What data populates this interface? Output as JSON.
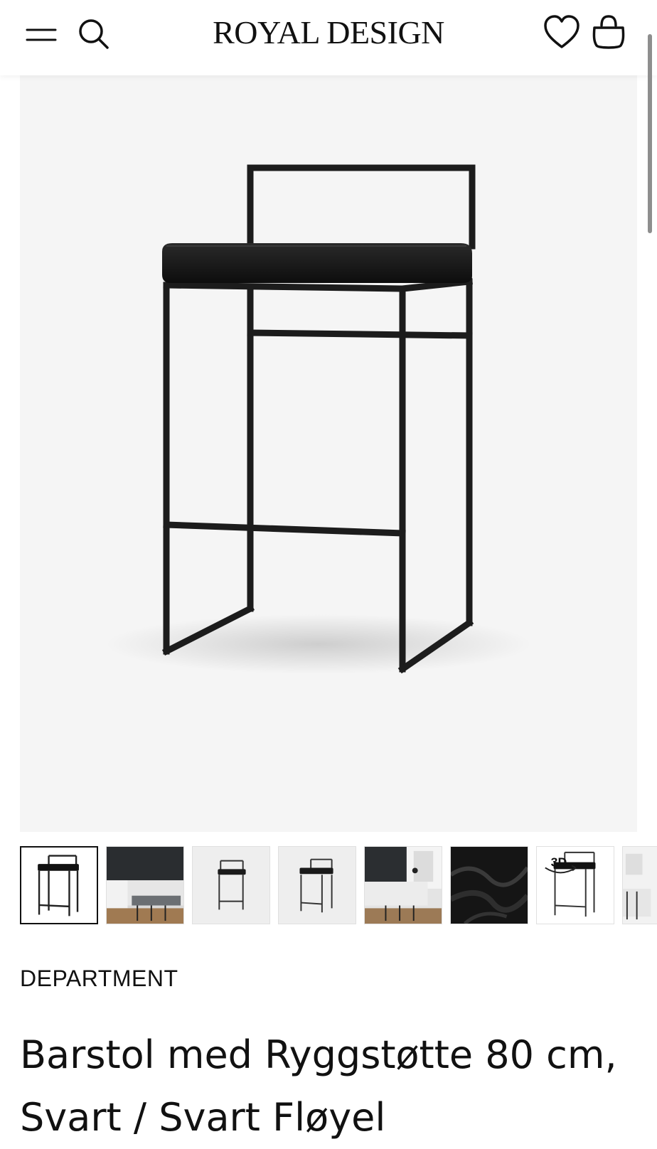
{
  "header": {
    "logo": "ROYAL DESIGN",
    "icons": {
      "menu": "hamburger-menu-icon",
      "search": "search-icon",
      "favorites": "heart-icon",
      "cart": "shopping-bag-icon"
    }
  },
  "gallery": {
    "main_image": "bar-stool-product-image",
    "thumbnails": [
      {
        "name": "stool-front-view",
        "active": true
      },
      {
        "name": "kitchen-scene"
      },
      {
        "name": "stool-side-view"
      },
      {
        "name": "stool-angle-view"
      },
      {
        "name": "kitchen-scene-2"
      },
      {
        "name": "black-velvet-fabric"
      },
      {
        "name": "stool-3d-view",
        "badge": "3D"
      },
      {
        "name": "room-scene-partial"
      }
    ]
  },
  "product": {
    "brand": "DEPARTMENT",
    "title": "Barstol med Ryggstøtte 80 cm, Svart / Svart Fløyel"
  },
  "colors": {
    "text": "#111111",
    "hero_background": "#f5f5f5",
    "frame": "#1c1c1c"
  }
}
